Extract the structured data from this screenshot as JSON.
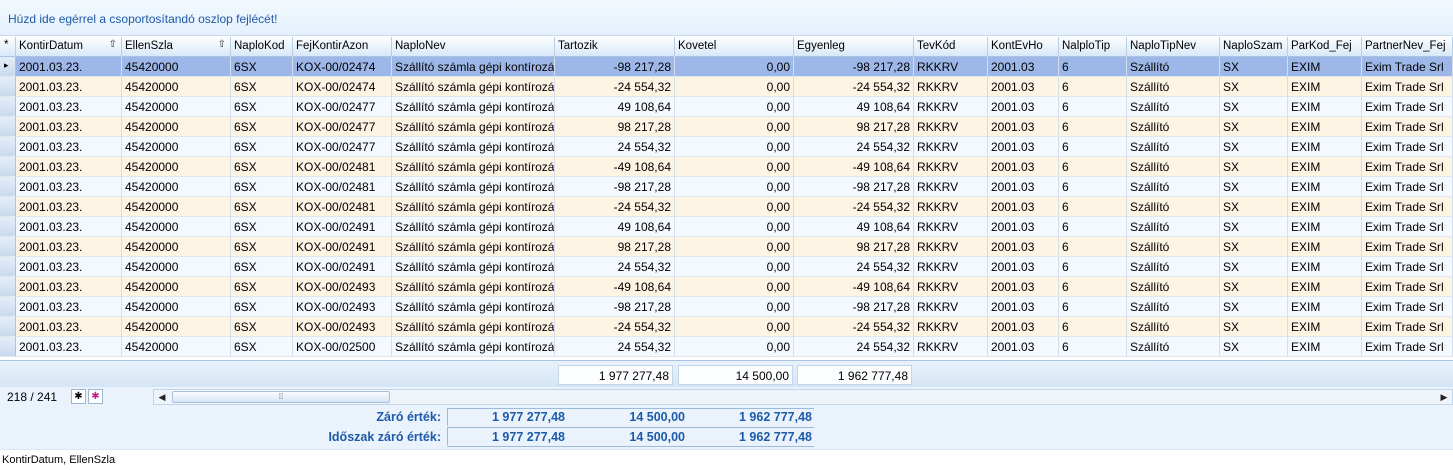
{
  "group_panel_text": "Húzd ide egérrel a csoportosítandó oszlop fejlécét!",
  "columns": [
    {
      "key": "ind",
      "label": "*",
      "align": "l"
    },
    {
      "key": "KontirDatum",
      "label": "KontirDatum",
      "sort": "⇧",
      "align": "l"
    },
    {
      "key": "EllenSzla",
      "label": "EllenSzla",
      "sort": "⇧",
      "align": "l"
    },
    {
      "key": "NaploKod",
      "label": "NaploKod",
      "align": "l"
    },
    {
      "key": "FejKontirAzon",
      "label": "FejKontirAzon",
      "align": "l"
    },
    {
      "key": "NaploNev",
      "label": "NaploNev",
      "align": "l"
    },
    {
      "key": "Tartozik",
      "label": "Tartozik",
      "align": "r"
    },
    {
      "key": "Kovetel",
      "label": "Kovetel",
      "align": "r"
    },
    {
      "key": "Egyenleg",
      "label": "Egyenleg",
      "align": "r"
    },
    {
      "key": "TevKod",
      "label": "TevKód",
      "align": "l"
    },
    {
      "key": "KontEvHo",
      "label": "KontEvHo",
      "align": "l"
    },
    {
      "key": "NalploTip",
      "label": "NalploTip",
      "align": "l"
    },
    {
      "key": "NaploTipNev",
      "label": "NaploTipNev",
      "align": "l"
    },
    {
      "key": "NaploSzam",
      "label": "NaploSzam",
      "align": "l"
    },
    {
      "key": "ParKod_Fej",
      "label": "ParKod_Fej",
      "align": "l"
    },
    {
      "key": "PartnerNev_Fej",
      "label": "PartnerNev_Fej",
      "align": "l"
    }
  ],
  "rows": [
    [
      "▸",
      "2001.03.23.",
      "45420000",
      "6SX",
      "KOX-00/02474",
      "Szállító számla gépi kontírozás",
      "-98 217,28",
      "0,00",
      "-98 217,28",
      "RKKRV",
      "2001.03",
      "6",
      "Szállító",
      "SX",
      "EXIM",
      "Exim Trade Srl"
    ],
    [
      "",
      "2001.03.23.",
      "45420000",
      "6SX",
      "KOX-00/02474",
      "Szállító számla gépi kontírozás",
      "-24 554,32",
      "0,00",
      "-24 554,32",
      "RKKRV",
      "2001.03",
      "6",
      "Szállító",
      "SX",
      "EXIM",
      "Exim Trade Srl"
    ],
    [
      "",
      "2001.03.23.",
      "45420000",
      "6SX",
      "KOX-00/02477",
      "Szállító számla gépi kontírozás",
      "49 108,64",
      "0,00",
      "49 108,64",
      "RKKRV",
      "2001.03",
      "6",
      "Szállító",
      "SX",
      "EXIM",
      "Exim Trade Srl"
    ],
    [
      "",
      "2001.03.23.",
      "45420000",
      "6SX",
      "KOX-00/02477",
      "Szállító számla gépi kontírozás",
      "98 217,28",
      "0,00",
      "98 217,28",
      "RKKRV",
      "2001.03",
      "6",
      "Szállító",
      "SX",
      "EXIM",
      "Exim Trade Srl"
    ],
    [
      "",
      "2001.03.23.",
      "45420000",
      "6SX",
      "KOX-00/02477",
      "Szállító számla gépi kontírozás",
      "24 554,32",
      "0,00",
      "24 554,32",
      "RKKRV",
      "2001.03",
      "6",
      "Szállító",
      "SX",
      "EXIM",
      "Exim Trade Srl"
    ],
    [
      "",
      "2001.03.23.",
      "45420000",
      "6SX",
      "KOX-00/02481",
      "Szállító számla gépi kontírozás",
      "-49 108,64",
      "0,00",
      "-49 108,64",
      "RKKRV",
      "2001.03",
      "6",
      "Szállító",
      "SX",
      "EXIM",
      "Exim Trade Srl"
    ],
    [
      "",
      "2001.03.23.",
      "45420000",
      "6SX",
      "KOX-00/02481",
      "Szállító számla gépi kontírozás",
      "-98 217,28",
      "0,00",
      "-98 217,28",
      "RKKRV",
      "2001.03",
      "6",
      "Szállító",
      "SX",
      "EXIM",
      "Exim Trade Srl"
    ],
    [
      "",
      "2001.03.23.",
      "45420000",
      "6SX",
      "KOX-00/02481",
      "Szállító számla gépi kontírozás",
      "-24 554,32",
      "0,00",
      "-24 554,32",
      "RKKRV",
      "2001.03",
      "6",
      "Szállító",
      "SX",
      "EXIM",
      "Exim Trade Srl"
    ],
    [
      "",
      "2001.03.23.",
      "45420000",
      "6SX",
      "KOX-00/02491",
      "Szállító számla gépi kontírozás",
      "49 108,64",
      "0,00",
      "49 108,64",
      "RKKRV",
      "2001.03",
      "6",
      "Szállító",
      "SX",
      "EXIM",
      "Exim Trade Srl"
    ],
    [
      "",
      "2001.03.23.",
      "45420000",
      "6SX",
      "KOX-00/02491",
      "Szállító számla gépi kontírozás",
      "98 217,28",
      "0,00",
      "98 217,28",
      "RKKRV",
      "2001.03",
      "6",
      "Szállító",
      "SX",
      "EXIM",
      "Exim Trade Srl"
    ],
    [
      "",
      "2001.03.23.",
      "45420000",
      "6SX",
      "KOX-00/02491",
      "Szállító számla gépi kontírozás",
      "24 554,32",
      "0,00",
      "24 554,32",
      "RKKRV",
      "2001.03",
      "6",
      "Szállító",
      "SX",
      "EXIM",
      "Exim Trade Srl"
    ],
    [
      "",
      "2001.03.23.",
      "45420000",
      "6SX",
      "KOX-00/02493",
      "Szállító számla gépi kontírozás",
      "-49 108,64",
      "0,00",
      "-49 108,64",
      "RKKRV",
      "2001.03",
      "6",
      "Szállító",
      "SX",
      "EXIM",
      "Exim Trade Srl"
    ],
    [
      "",
      "2001.03.23.",
      "45420000",
      "6SX",
      "KOX-00/02493",
      "Szállító számla gépi kontírozás",
      "-98 217,28",
      "0,00",
      "-98 217,28",
      "RKKRV",
      "2001.03",
      "6",
      "Szállító",
      "SX",
      "EXIM",
      "Exim Trade Srl"
    ],
    [
      "",
      "2001.03.23.",
      "45420000",
      "6SX",
      "KOX-00/02493",
      "Szállító számla gépi kontírozás",
      "-24 554,32",
      "0,00",
      "-24 554,32",
      "RKKRV",
      "2001.03",
      "6",
      "Szállító",
      "SX",
      "EXIM",
      "Exim Trade Srl"
    ],
    [
      "",
      "2001.03.23.",
      "45420000",
      "6SX",
      "KOX-00/02500",
      "Szállító számla gépi kontírozás",
      "24 554,32",
      "0,00",
      "24 554,32",
      "RKKRV",
      "2001.03",
      "6",
      "Szállító",
      "SX",
      "EXIM",
      "Exim Trade Srl"
    ]
  ],
  "footer_totals": {
    "tartozik": "1 977 277,48",
    "kovetel": "14 500,00",
    "egyenleg": "1 962 777,48"
  },
  "navigator": {
    "counter": "218 / 241",
    "add_icon": "✱",
    "filter_icon": "✱"
  },
  "summary": {
    "zaro_label": "Záró érték:",
    "zaro_tartozik": "1 977 277,48",
    "zaro_kovetel": "14 500,00",
    "zaro_egyenleg": "1 962 777,48",
    "idoszak_label": "Időszak záró érték:",
    "idoszak_tartozik": "1 977 277,48",
    "idoszak_kovetel": "14 500,00",
    "idoszak_egyenleg": "1 962 777,48"
  },
  "status_text": "KontirDatum, EllenSzla"
}
